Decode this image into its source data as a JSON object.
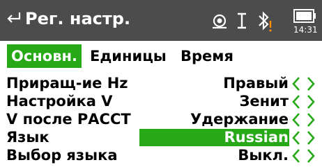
{
  "header": {
    "title": "Рег. настр.",
    "time": "14:31",
    "icons": [
      "back-arrow-icon",
      "prism-target-icon",
      "i-beam-icon",
      "bluetooth-warning-icon",
      "battery-icon"
    ]
  },
  "tabs": [
    {
      "label": "Основн.",
      "active": true
    },
    {
      "label": "Единицы",
      "active": false
    },
    {
      "label": "Время",
      "active": false
    }
  ],
  "settings": [
    {
      "label": "Приращ-ие Hz",
      "value": "Правый",
      "selected": false
    },
    {
      "label": "Настройка V",
      "value": "Зенит",
      "selected": false
    },
    {
      "label": "V после РАССТ",
      "value": "Удержание",
      "selected": false
    },
    {
      "label": "Язык",
      "value": "Russian",
      "selected": true
    },
    {
      "label": "Выбор языка",
      "value": "Выкл.",
      "selected": false
    }
  ],
  "colors": {
    "titlebar": "#4c4c4c",
    "accent_green": "#26a817",
    "warning_orange": "#ff8c00"
  }
}
